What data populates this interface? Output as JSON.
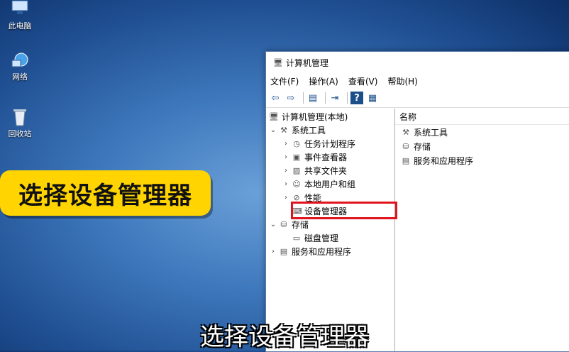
{
  "desktop": {
    "icons": [
      {
        "label": "此电脑",
        "icon": "computer-icon"
      },
      {
        "label": "网络",
        "icon": "network-icon"
      },
      {
        "label": "回收站",
        "icon": "recycle-bin-icon"
      }
    ]
  },
  "banner": {
    "text": "选择设备管理器",
    "color": "#ffd400"
  },
  "subtitle": {
    "text": "选择设备管理器"
  },
  "window": {
    "title": "计算机管理",
    "menu": [
      "文件(F)",
      "操作(A)",
      "查看(V)",
      "帮助(H)"
    ],
    "toolbar": [
      "back-icon",
      "forward-icon",
      "show-hide-tree-icon",
      "export-icon",
      "help-icon",
      "properties-icon"
    ],
    "tree": [
      {
        "label": "计算机管理(本地)",
        "icon": "computer-management-icon",
        "arrow": ""
      },
      {
        "label": "系统工具",
        "icon": "system-tools-icon",
        "arrow": "expanded"
      },
      {
        "label": "任务计划程序",
        "icon": "task-scheduler-icon",
        "arrow": "collapsed"
      },
      {
        "label": "事件查看器",
        "icon": "event-viewer-icon",
        "arrow": "collapsed"
      },
      {
        "label": "共享文件夹",
        "icon": "shared-folders-icon",
        "arrow": "collapsed"
      },
      {
        "label": "本地用户和组",
        "icon": "local-users-icon",
        "arrow": "collapsed"
      },
      {
        "label": "性能",
        "icon": "performance-icon",
        "arrow": "collapsed"
      },
      {
        "label": "设备管理器",
        "icon": "device-manager-icon",
        "arrow": ""
      },
      {
        "label": "存储",
        "icon": "storage-icon",
        "arrow": "expanded"
      },
      {
        "label": "磁盘管理",
        "icon": "disk-management-icon",
        "arrow": ""
      },
      {
        "label": "服务和应用程序",
        "icon": "services-apps-icon",
        "arrow": "collapsed"
      }
    ],
    "right": {
      "header": "名称",
      "items": [
        {
          "label": "系统工具",
          "icon": "system-tools-icon"
        },
        {
          "label": "存储",
          "icon": "storage-icon"
        },
        {
          "label": "服务和应用程序",
          "icon": "services-apps-icon"
        }
      ]
    },
    "highlight_color": "#e0141e"
  }
}
